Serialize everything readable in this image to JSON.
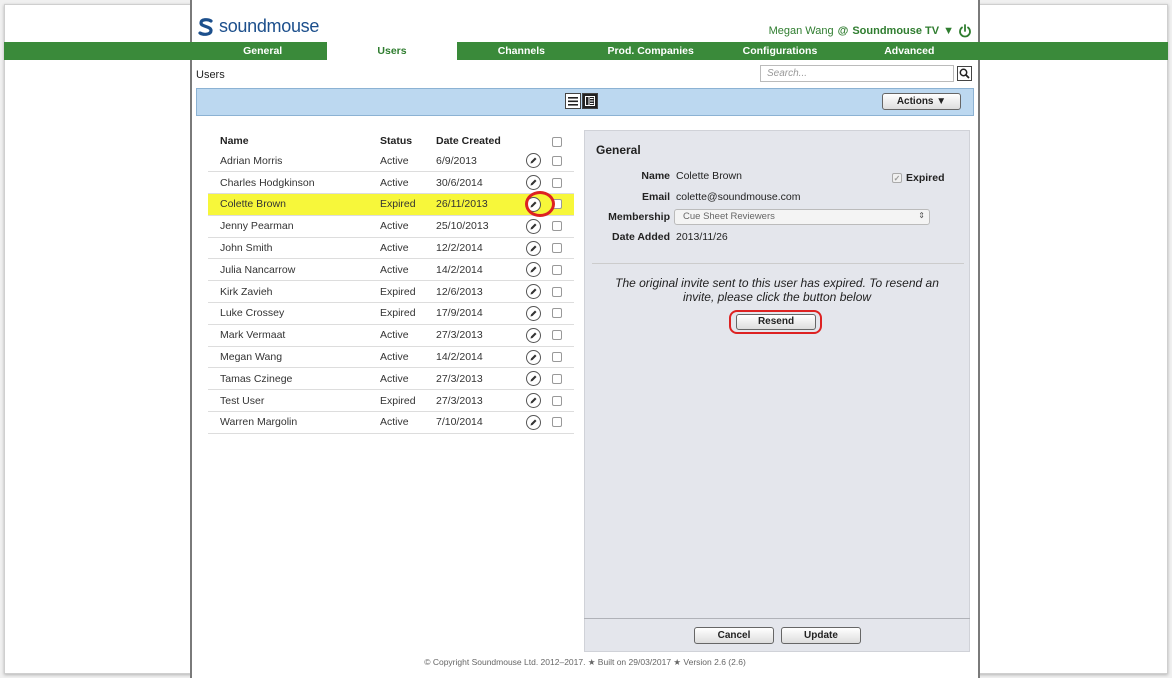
{
  "app": {
    "logo_text": "soundmouse"
  },
  "header": {
    "user_name": "Megan Wang",
    "at_symbol": "@",
    "account": "Soundmouse TV",
    "dropdown_glyph": "▼"
  },
  "nav": {
    "tabs": [
      {
        "label": "General"
      },
      {
        "label": "Users"
      },
      {
        "label": "Channels"
      },
      {
        "label": "Prod. Companies"
      },
      {
        "label": "Configurations"
      },
      {
        "label": "Advanced"
      }
    ],
    "active_tab": "Users"
  },
  "page": {
    "title": "Users",
    "search_placeholder": "Search..."
  },
  "toolbar": {
    "actions_label": "Actions ▼"
  },
  "table": {
    "headers": {
      "name": "Name",
      "status": "Status",
      "date": "Date Created"
    },
    "rows": [
      {
        "name": "Adrian Morris",
        "status": "Active",
        "date": "6/9/2013"
      },
      {
        "name": "Charles Hodgkinson",
        "status": "Active",
        "date": "30/6/2014"
      },
      {
        "name": "Colette Brown",
        "status": "Expired",
        "date": "26/11/2013"
      },
      {
        "name": "Jenny Pearman",
        "status": "Active",
        "date": "25/10/2013"
      },
      {
        "name": "John Smith",
        "status": "Active",
        "date": "12/2/2014"
      },
      {
        "name": "Julia Nancarrow",
        "status": "Active",
        "date": "14/2/2014"
      },
      {
        "name": "Kirk Zavieh",
        "status": "Expired",
        "date": "12/6/2013"
      },
      {
        "name": "Luke Crossey",
        "status": "Expired",
        "date": "17/9/2014"
      },
      {
        "name": "Mark Vermaat",
        "status": "Active",
        "date": "27/3/2013"
      },
      {
        "name": "Megan Wang",
        "status": "Active",
        "date": "14/2/2014"
      },
      {
        "name": "Tamas Czinege",
        "status": "Active",
        "date": "27/3/2013"
      },
      {
        "name": "Test User",
        "status": "Expired",
        "date": "27/3/2013"
      },
      {
        "name": "Warren Margolin",
        "status": "Active",
        "date": "7/10/2014"
      }
    ]
  },
  "detail": {
    "section_title": "General",
    "name_label": "Name",
    "name_value": "Colette Brown",
    "expired_label": "Expired",
    "email_label": "Email",
    "email_value": "colette@soundmouse.com",
    "membership_label": "Membership",
    "membership_value": "Cue Sheet Reviewers",
    "date_added_label": "Date Added",
    "date_added_value": "2013/11/26",
    "invite_message": "The original invite sent to this user has expired. To resend an invite, please click the button below",
    "resend_label": "Resend",
    "cancel_label": "Cancel",
    "update_label": "Update"
  },
  "footer": {
    "copyright": "© Copyright Soundmouse Ltd. 2012–2017. ★ Built on 29/03/2017 ★ Version 2.6 (2.6)"
  },
  "colors": {
    "nav_green": "#3a8a3a",
    "brand_blue": "#1c4f8c",
    "toolbar_blue": "#bcd8f0",
    "highlight_yellow": "#f7f73a",
    "annotation_red": "#dd2222"
  }
}
